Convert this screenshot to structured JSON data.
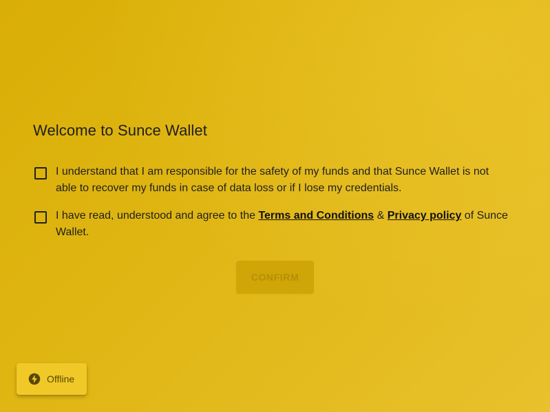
{
  "welcome": {
    "title": "Welcome to Sunce Wallet",
    "responsibility_text": "I understand that I am responsible for the safety of my funds and that Sunce Wallet is not able to recover my funds in case of data loss or if I lose my credentials.",
    "terms_prefix": "I have read, understood and agree to the ",
    "terms_link": "Terms and Conditions",
    "terms_amp": " & ",
    "privacy_link": "Privacy policy",
    "terms_suffix": " of Sunce Wallet.",
    "confirm_label": "CONFIRM"
  },
  "status": {
    "label": "Offline",
    "icon": "bolt-icon"
  },
  "colors": {
    "background": "#e0b614",
    "confirm_disabled_bg": "#cfa507",
    "confirm_disabled_text": "#b48e0a",
    "chip_bg": "#f0c928"
  }
}
